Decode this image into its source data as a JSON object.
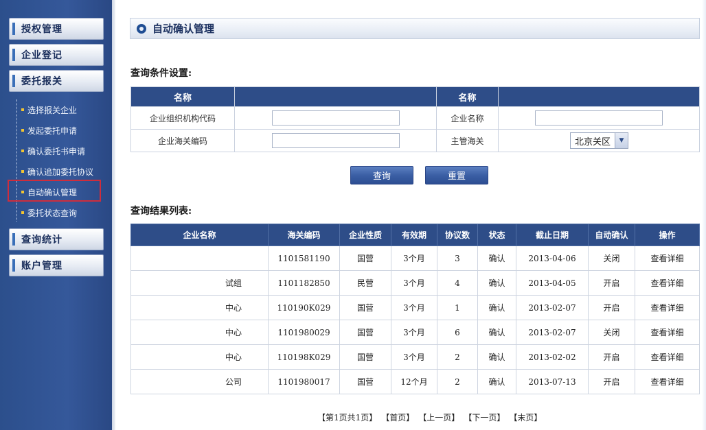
{
  "sidebar": {
    "groups": [
      {
        "label": "授权管理"
      },
      {
        "label": "企业登记"
      },
      {
        "label": "委托报关"
      },
      {
        "label": "查询统计"
      },
      {
        "label": "账户管理"
      }
    ],
    "subitems": [
      {
        "label": "选择报关企业"
      },
      {
        "label": "发起委托申请"
      },
      {
        "label": "确认委托书申请"
      },
      {
        "label": "确认追加委托协议"
      },
      {
        "label": "自动确认管理"
      },
      {
        "label": "委托状态查询"
      }
    ],
    "active_subitem": "自动确认管理"
  },
  "header": {
    "title": "自动确认管理"
  },
  "query": {
    "section_title": "查询条件设置:",
    "col_header_1": "名称",
    "col_header_2": "名称",
    "org_code_label": "企业组织机构代码",
    "org_code_value": "",
    "company_name_label": "企业名称",
    "company_name_value": "",
    "customs_code_label": "企业海关编码",
    "customs_code_value": "",
    "customs_office_label": "主管海关",
    "customs_office_value": "北京关区"
  },
  "buttons": {
    "search": "查询",
    "reset": "重置"
  },
  "results": {
    "section_title": "查询结果列表:",
    "columns": [
      "企业名称",
      "海关编码",
      "企业性质",
      "有效期",
      "协议数",
      "状态",
      "截止日期",
      "自动确认",
      "操作"
    ],
    "rows": [
      {
        "name": "",
        "code": "1101581190",
        "nature": "国营",
        "validity": "3个月",
        "count": "3",
        "status": "确认",
        "deadline": "2013-04-06",
        "auto": "关闭",
        "action": "查看详细"
      },
      {
        "name": "试组",
        "code": "1101182850",
        "nature": "民营",
        "validity": "3个月",
        "count": "4",
        "status": "确认",
        "deadline": "2013-04-05",
        "auto": "开启",
        "action": "查看详细"
      },
      {
        "name": "中心",
        "code": "110190K029",
        "nature": "国营",
        "validity": "3个月",
        "count": "1",
        "status": "确认",
        "deadline": "2013-02-07",
        "auto": "开启",
        "action": "查看详细"
      },
      {
        "name": "中心",
        "code": "1101980029",
        "nature": "国营",
        "validity": "3个月",
        "count": "6",
        "status": "确认",
        "deadline": "2013-02-07",
        "auto": "关闭",
        "action": "查看详细"
      },
      {
        "name": "中心",
        "code": "110198K029",
        "nature": "国营",
        "validity": "3个月",
        "count": "2",
        "status": "确认",
        "deadline": "2013-02-02",
        "auto": "开启",
        "action": "查看详细"
      },
      {
        "name": "公司",
        "code": "1101980017",
        "nature": "国营",
        "validity": "12个月",
        "count": "2",
        "status": "确认",
        "deadline": "2013-07-13",
        "auto": "开启",
        "action": "查看详细"
      }
    ]
  },
  "pager": {
    "info": "【第1页共1页】",
    "first": "【首页】",
    "prev": "【上一页】",
    "next": "【下一页】",
    "last": "【末页】"
  },
  "colors": {
    "sidebar_bg": "#35589a",
    "header_bg": "#2e4d88",
    "highlight_border": "#cf2d3c",
    "bullet": "#f3c531"
  }
}
